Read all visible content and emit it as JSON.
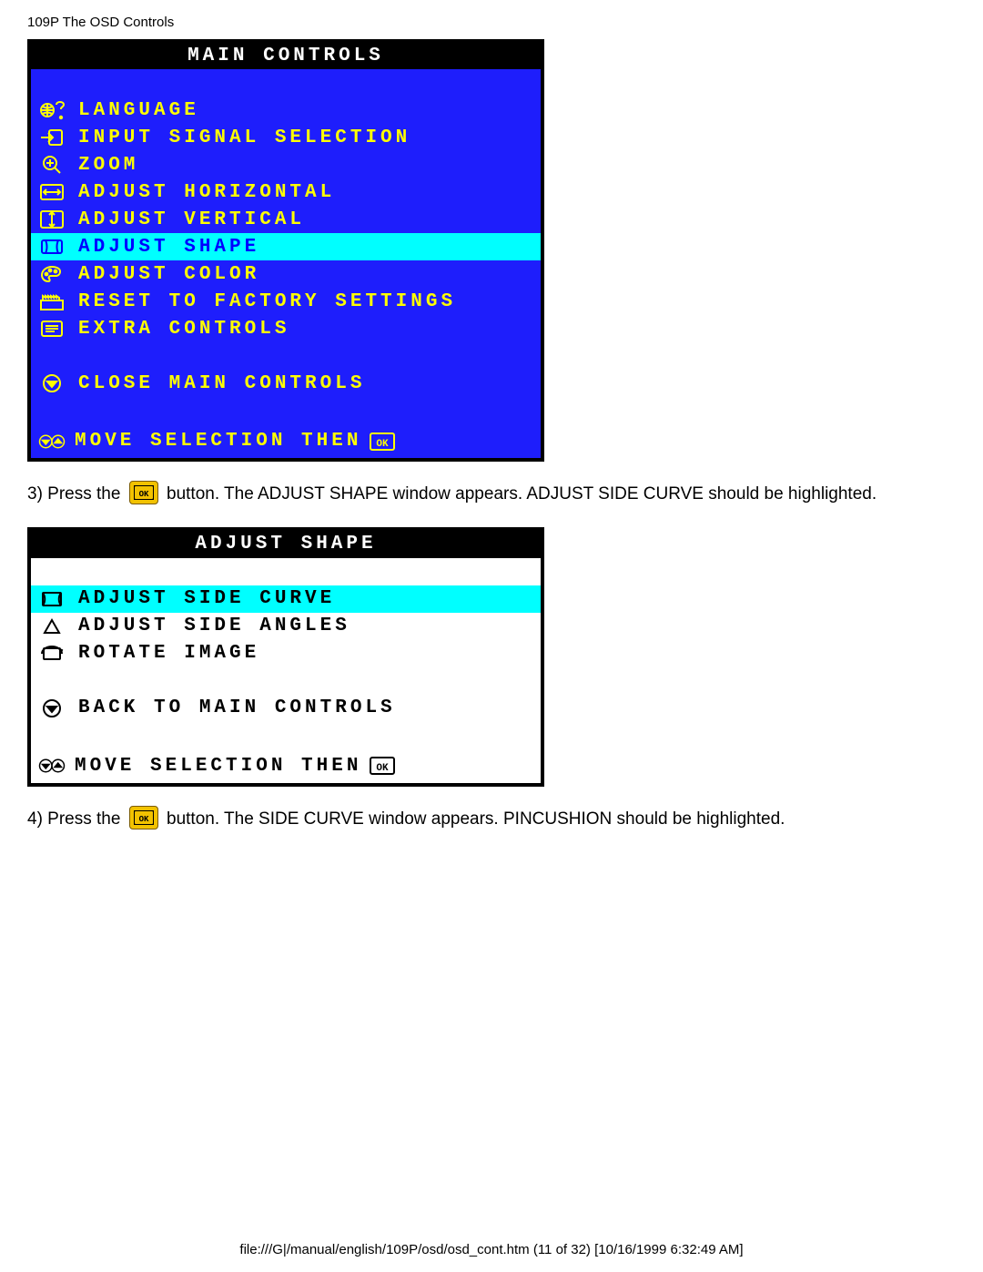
{
  "header": "109P The OSD Controls",
  "main": {
    "title": "MAIN CONTROLS",
    "items": [
      {
        "label": "LANGUAGE",
        "icon": "globe-question-icon",
        "hi": false
      },
      {
        "label": "INPUT SIGNAL SELECTION",
        "icon": "input-arrow-icon",
        "hi": false
      },
      {
        "label": "ZOOM",
        "icon": "magnifier-plus-icon",
        "hi": false
      },
      {
        "label": "ADJUST HORIZONTAL",
        "icon": "adjust-horizontal-icon",
        "hi": false
      },
      {
        "label": "ADJUST VERTICAL",
        "icon": "adjust-vertical-icon",
        "hi": false
      },
      {
        "label": "ADJUST SHAPE",
        "icon": "adjust-shape-icon",
        "hi": true
      },
      {
        "label": "ADJUST COLOR",
        "icon": "palette-icon",
        "hi": false
      },
      {
        "label": "RESET TO FACTORY SETTINGS",
        "icon": "factory-reset-icon",
        "hi": false
      },
      {
        "label": "EXTRA CONTROLS",
        "icon": "extra-controls-icon",
        "hi": false
      }
    ],
    "close": "CLOSE MAIN CONTROLS",
    "hint": "MOVE SELECTION THEN"
  },
  "step3": {
    "prefix": "3) Press the ",
    "suffix": " button. The ADJUST SHAPE window appears. ADJUST SIDE CURVE should be highlighted."
  },
  "shape": {
    "title": "ADJUST SHAPE",
    "items": [
      {
        "label": "ADJUST SIDE CURVE",
        "icon": "side-curve-icon",
        "hi": true
      },
      {
        "label": "ADJUST SIDE ANGLES",
        "icon": "side-angles-icon",
        "hi": false
      },
      {
        "label": "ROTATE IMAGE",
        "icon": "rotate-image-icon",
        "hi": false
      }
    ],
    "back": "BACK TO MAIN CONTROLS",
    "hint": "MOVE SELECTION THEN"
  },
  "step4": {
    "prefix": "4) Press the ",
    "suffix": " button. The SIDE CURVE window appears. PINCUSHION should be highlighted."
  },
  "footer": "file:///G|/manual/english/109P/osd/osd_cont.htm (11 of 32) [10/16/1999 6:32:49 AM]"
}
